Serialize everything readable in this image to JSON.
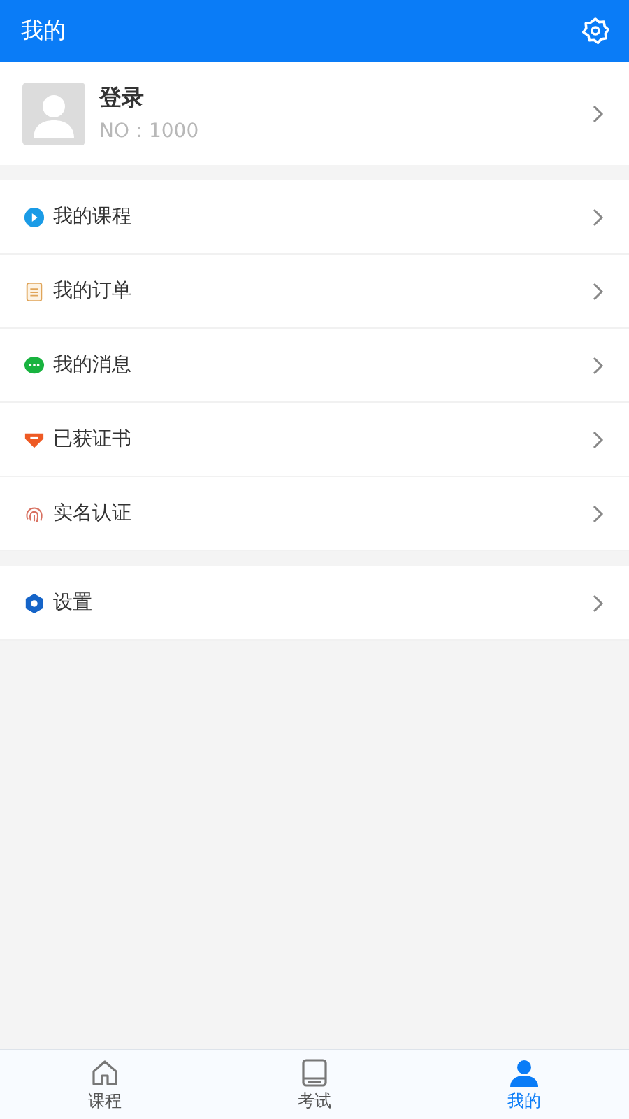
{
  "header": {
    "title": "我的"
  },
  "profile": {
    "name": "登录",
    "number": "NO：1000"
  },
  "menu_groups": [
    [
      {
        "kind": "play",
        "label": "我的课程"
      },
      {
        "kind": "order",
        "label": "我的订单"
      },
      {
        "kind": "message",
        "label": "我的消息"
      },
      {
        "kind": "certificate",
        "label": "已获证书"
      },
      {
        "kind": "fingerprint",
        "label": "实名认证"
      }
    ],
    [
      {
        "kind": "settings",
        "label": "设置"
      }
    ]
  ],
  "tabs": [
    {
      "kind": "home",
      "label": "课程",
      "selected": false
    },
    {
      "kind": "book",
      "label": "考试",
      "selected": false
    },
    {
      "kind": "person",
      "label": "我的",
      "selected": true
    }
  ]
}
